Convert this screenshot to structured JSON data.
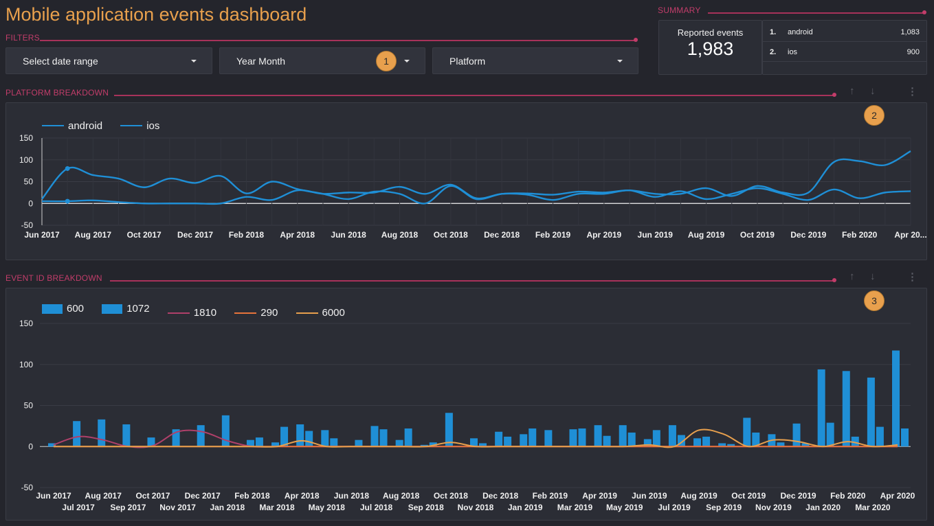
{
  "title": "Mobile application events dashboard",
  "filters": {
    "label": "FILTERS",
    "date_range": "Select date range",
    "year_month": "Year Month",
    "platform": "Platform"
  },
  "summary": {
    "label": "SUMMARY",
    "reported_label": "Reported events",
    "reported_value": "1,983",
    "rows": [
      {
        "idx": "1.",
        "name": "android",
        "value": "1,083"
      },
      {
        "idx": "2.",
        "name": "ios",
        "value": "900"
      }
    ]
  },
  "badges": [
    "1",
    "2",
    "3"
  ],
  "platform_section": {
    "label": "PLATFORM BREAKDOWN"
  },
  "event_section": {
    "label": "EVENT ID BREAKDOWN"
  },
  "icons": {
    "up": "arrow-up-icon",
    "down": "arrow-down-icon",
    "more": "more-vert-icon"
  },
  "colors": {
    "accent": "#e8a04d",
    "section": "#c23d6a",
    "bar": "#1f8fd6",
    "line_1810": "#b0406a",
    "line_290": "#e8743b",
    "line_6000": "#e8a04d"
  },
  "chart_data": [
    {
      "type": "line",
      "title": "",
      "series_names": [
        "android",
        "ios"
      ],
      "x_tick_labels": [
        "Jun 2017",
        "Aug 2017",
        "Oct 2017",
        "Dec 2017",
        "Feb 2018",
        "Apr 2018",
        "Jun 2018",
        "Aug 2018",
        "Oct 2018",
        "Dec 2018",
        "Feb 2019",
        "Apr 2019",
        "Jun 2019",
        "Aug 2019",
        "Oct 2019",
        "Dec 2019",
        "Feb 2020",
        "Apr 20..."
      ],
      "y_ticks": [
        150,
        100,
        50,
        0,
        -50
      ],
      "ylim": [
        -50,
        150
      ],
      "x": [
        "2017-06",
        "2017-07",
        "2017-08",
        "2017-09",
        "2017-10",
        "2017-11",
        "2017-12",
        "2018-01",
        "2018-02",
        "2018-03",
        "2018-04",
        "2018-05",
        "2018-06",
        "2018-07",
        "2018-08",
        "2018-09",
        "2018-10",
        "2018-11",
        "2018-12",
        "2019-01",
        "2019-02",
        "2019-03",
        "2019-04",
        "2019-05",
        "2019-06",
        "2019-07",
        "2019-08",
        "2019-09",
        "2019-10",
        "2019-11",
        "2019-12",
        "2020-01",
        "2020-02",
        "2020-03",
        "2020-04"
      ],
      "series": [
        {
          "name": "android",
          "values": [
            10,
            80,
            65,
            57,
            37,
            57,
            47,
            63,
            23,
            50,
            33,
            22,
            10,
            27,
            22,
            0,
            40,
            10,
            22,
            23,
            20,
            27,
            25,
            30,
            22,
            22,
            35,
            17,
            40,
            25,
            25,
            95,
            97,
            88,
            120
          ]
        },
        {
          "name": "ios",
          "values": [
            5,
            5,
            7,
            3,
            0,
            0,
            0,
            0,
            15,
            8,
            30,
            22,
            25,
            25,
            38,
            22,
            43,
            12,
            22,
            20,
            8,
            22,
            22,
            30,
            15,
            28,
            10,
            22,
            35,
            22,
            8,
            32,
            12,
            25,
            28
          ]
        }
      ]
    },
    {
      "type": "bar",
      "title": "",
      "legend": [
        "600",
        "1072",
        "1810",
        "290",
        "6000"
      ],
      "x_tick_labels_row1": [
        "Jun 2017",
        "Aug 2017",
        "Oct 2017",
        "Dec 2017",
        "Feb 2018",
        "Apr 2018",
        "Jun 2018",
        "Aug 2018",
        "Oct 2018",
        "Dec 2018",
        "Feb 2019",
        "Apr 2019",
        "Jun 2019",
        "Aug 2019",
        "Oct 2019",
        "Dec 2019",
        "Feb 2020",
        "Apr 2020"
      ],
      "x_tick_labels_row2": [
        "Jul 2017",
        "Sep 2017",
        "Nov 2017",
        "Jan 2018",
        "Mar 2018",
        "May 2018",
        "Jul 2018",
        "Sep 2018",
        "Nov 2018",
        "Jan 2019",
        "Mar 2019",
        "May 2019",
        "Jul 2019",
        "Sep 2019",
        "Nov 2019",
        "Jan 2020",
        "Mar 2020"
      ],
      "y_ticks": [
        150,
        100,
        50,
        0,
        -50
      ],
      "ylim": [
        -50,
        150
      ],
      "x": [
        "2017-06",
        "2017-07",
        "2017-08",
        "2017-09",
        "2017-10",
        "2017-11",
        "2017-12",
        "2018-01",
        "2018-02",
        "2018-03",
        "2018-04",
        "2018-05",
        "2018-06",
        "2018-07",
        "2018-08",
        "2018-09",
        "2018-10",
        "2018-11",
        "2018-12",
        "2019-01",
        "2019-02",
        "2019-03",
        "2019-04",
        "2019-05",
        "2019-06",
        "2019-07",
        "2019-08",
        "2019-09",
        "2019-10",
        "2019-11",
        "2019-12",
        "2020-01",
        "2020-02",
        "2020-03",
        "2020-04"
      ],
      "series": [
        {
          "name": "600",
          "type": "bar",
          "values": [
            4,
            31,
            33,
            27,
            11,
            21,
            26,
            38,
            8,
            5,
            27,
            20,
            0,
            25,
            8,
            2,
            41,
            10,
            18,
            15,
            20,
            21,
            26,
            26,
            9,
            26,
            10,
            4,
            35,
            15,
            28,
            94,
            92,
            84,
            117
          ]
        },
        {
          "name": "1072",
          "type": "bar",
          "values": [
            0,
            0,
            0,
            0,
            0,
            0,
            0,
            0,
            11,
            24,
            19,
            10,
            8,
            21,
            22,
            5,
            0,
            4,
            12,
            22,
            0,
            22,
            13,
            17,
            20,
            14,
            12,
            3,
            17,
            5,
            4,
            29,
            12,
            24,
            22
          ]
        },
        {
          "name": "1810",
          "type": "line",
          "values": [
            2,
            12,
            8,
            0,
            1,
            18,
            18,
            7,
            0,
            0,
            0,
            0,
            0,
            0,
            0,
            0,
            0,
            0,
            0,
            0,
            0,
            0,
            0,
            0,
            0,
            0,
            0,
            0,
            0,
            0,
            0,
            0,
            0,
            0,
            0
          ]
        },
        {
          "name": "290",
          "type": "line",
          "values": [
            0,
            0,
            0,
            0,
            0,
            0,
            0,
            0,
            0,
            0,
            0,
            0,
            0,
            0,
            0,
            0,
            0,
            0,
            0,
            0,
            0,
            0,
            0,
            0,
            0,
            0,
            0,
            0,
            0,
            0,
            0,
            0,
            0,
            0,
            0
          ]
        },
        {
          "name": "6000",
          "type": "line",
          "values": [
            0,
            0,
            0,
            0,
            0,
            0,
            0,
            0,
            0,
            0,
            7,
            0,
            0,
            0,
            0,
            0,
            5,
            0,
            0,
            0,
            0,
            0,
            0,
            0,
            2,
            0,
            20,
            15,
            0,
            8,
            6,
            0,
            6,
            0,
            2
          ]
        }
      ]
    }
  ]
}
